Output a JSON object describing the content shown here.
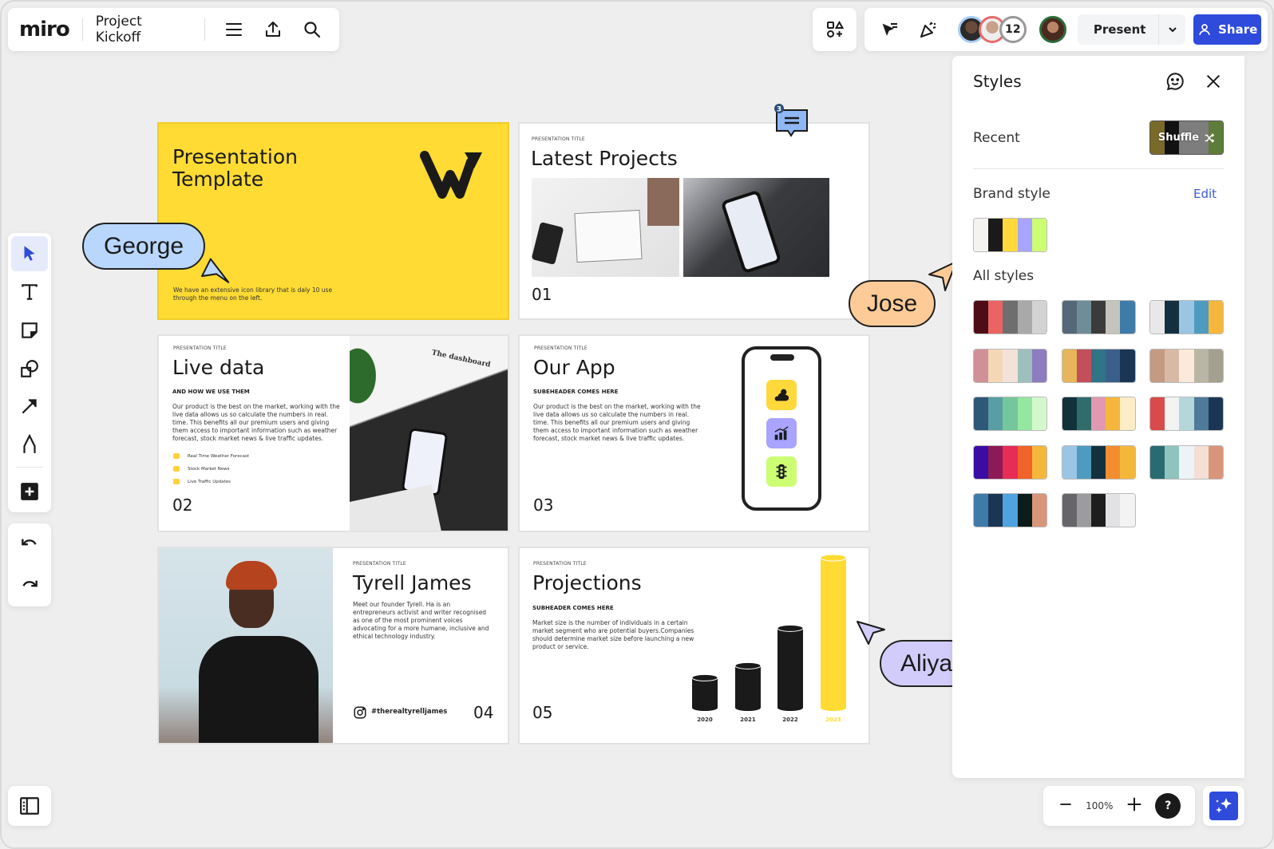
{
  "topbar": {
    "logo": "miro",
    "board_title": "Project Kickoff",
    "menu_icon": "hamburger-menu-icon",
    "export_icon": "upload-icon",
    "search_icon": "search-icon",
    "collaborator_count": "12",
    "present_label": "Present",
    "share_label": "Share"
  },
  "toolbar": {
    "tools": [
      "select",
      "text",
      "sticky-note",
      "shapes",
      "connection-line",
      "pen",
      "more-add"
    ],
    "undo": "undo",
    "redo": "redo"
  },
  "slides": {
    "s1": {
      "title": "Presentation Template",
      "description": "We have an extensive icon library that is daly 10 use through the menu on the left."
    },
    "s2": {
      "eyebrow": "PRESENTATION TITLE",
      "title": "Latest Projects",
      "number": "01"
    },
    "s3": {
      "eyebrow": "PRESENTATION TITLE",
      "title": "Live data",
      "subheader": "AND HOW WE USE THEM",
      "body": "Our product is the best on the market, working with the live data allows us so calculate the numbers in real. time. This benefits all our premium users and giving them access to important information such as weather forecast, stock market news & live traffic updates.",
      "features": [
        "Real Time Weather Forecast",
        "Stock Market News",
        "Live Traffic Updates"
      ],
      "number": "02",
      "image_caption": "The dashboard"
    },
    "s4": {
      "eyebrow": "PRESENTATION TITLE",
      "title": "Our App",
      "subheader": "SUBEHEADER COMES HERE",
      "body": "Our product is the best on the market, working with the live data allows us so calculate the numbers in real. time. This benefits all our premium users and giving them access to important information such as weather forecast, stock market news & live traffic updates.",
      "number": "03",
      "app_colors": [
        "#ffd93b",
        "#a8a4ff",
        "#ccfd73"
      ]
    },
    "s5": {
      "eyebrow": "PRESENTATION TITLE",
      "title": "Tyrell James",
      "body": "Meet our founder Tyrell. Ha is an entrepreneurs activist and writer recognised as one of the most prominent voices advocating for a more humane, inclusive and ethical technology industry.",
      "handle": "#therealtyrelljames",
      "number": "04"
    },
    "s6": {
      "eyebrow": "PRESENTATION TITLE",
      "title": "Projections",
      "subheader": "SUBHEADER COMES HERE",
      "body": "Market size is the number of individuals in a certain market segment who are potential buyers.Companies should determine market size before launching a new product or service.",
      "number": "05"
    }
  },
  "chart_data": {
    "type": "bar",
    "title": "",
    "categories": [
      "2020",
      "2021",
      "2022",
      "2023"
    ],
    "values": [
      20,
      28,
      53,
      100
    ],
    "highlight_index": 3,
    "colors": {
      "default": "#1a1a1a",
      "highlight": "#ffdb33"
    },
    "xlabel": "",
    "ylabel": "",
    "ylim": [
      0,
      100
    ]
  },
  "comment": {
    "count": "3"
  },
  "cursors": [
    {
      "name": "George",
      "color": "#b9d7fd"
    },
    {
      "name": "Jose",
      "color": "#fccb97"
    },
    {
      "name": "Aliya",
      "color": "#d2ccfb"
    }
  ],
  "styles_panel": {
    "title": "Styles",
    "recent_label": "Recent",
    "shuffle_label": "Shuffle",
    "shuffle_colors": [
      "#7a6a2a",
      "#111111",
      "#7d7d7d",
      "#7d7d7d",
      "#5f7d3a"
    ],
    "brand_label": "Brand style",
    "edit_label": "Edit",
    "brand_colors": [
      "#f5f3ef",
      "#1a1a1a",
      "#ffd93b",
      "#a8a4ff",
      "#ccfd73"
    ],
    "all_label": "All styles",
    "palettes": [
      [
        "#4e0d16",
        "#ea6464",
        "#6e6e6e",
        "#a9a9a9",
        "#d3d3d3"
      ],
      [
        "#546879",
        "#6f8d99",
        "#3b3b3b",
        "#c4c4bc",
        "#3f7ba8"
      ],
      [
        "#e8e8e8",
        "#14303f",
        "#9ac6e4",
        "#4f9bbf",
        "#f5b73b"
      ],
      [
        "#cf9097",
        "#f5d6b6",
        "#f3e2d8",
        "#9dc0bd",
        "#8e7cc0"
      ],
      [
        "#e7b55a",
        "#c34f5c",
        "#317387",
        "#3b5f8b",
        "#1b3655"
      ],
      [
        "#c49a82",
        "#d7b9a6",
        "#fbeadb",
        "#b9b6a5",
        "#a4a08f"
      ],
      [
        "#2e5878",
        "#589ea4",
        "#74c69d",
        "#95e6a0",
        "#d3f8cc"
      ],
      [
        "#11323b",
        "#2f6c6a",
        "#e298b0",
        "#f5b73b",
        "#fcecc8"
      ],
      [
        "#d94a4a",
        "#f3f3f3",
        "#b5d7dc",
        "#4f7a99",
        "#1b3654"
      ],
      [
        "#3a0ca3",
        "#8c1a56",
        "#e72d55",
        "#f0632a",
        "#f5b73b"
      ],
      [
        "#9ac6e4",
        "#4f9bbf",
        "#14303f",
        "#f28e30",
        "#f5b73b"
      ],
      [
        "#2a6b72",
        "#8fc3bd",
        "#edf3f7",
        "#f3dfd3",
        "#d9957a"
      ],
      [
        "#3f7ba8",
        "#1b3655",
        "#4ea3e0",
        "#0c1c1a",
        "#d9957a"
      ],
      [
        "#66666a",
        "#9c9c9f",
        "#1e1e1e",
        "#e2e2e4",
        "#f3f3f4"
      ]
    ]
  },
  "bottom": {
    "zoom_level": "100%",
    "help": "?"
  }
}
